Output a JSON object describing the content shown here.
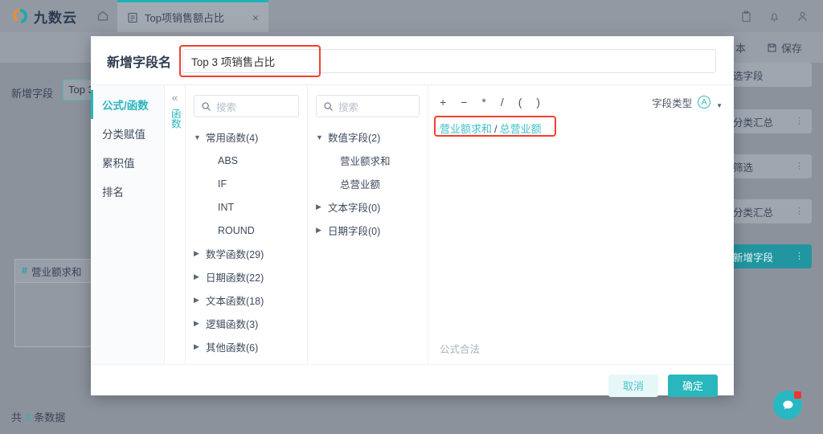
{
  "topbar": {
    "logo_text": "九数云",
    "logo_icon": "nine-cloud-logo",
    "home_icon": "home-icon",
    "tab": {
      "icon": "document-icon",
      "label": "Top项销售额占比",
      "close": "×"
    },
    "right_icons": [
      "clipboard-icon",
      "bell-icon",
      "user-icon"
    ]
  },
  "subbar": {
    "version_label": "本",
    "save_icon": "save-icon",
    "save_label": "保存"
  },
  "background": {
    "add_field_label": "新增字段",
    "chip_label": "Top 3",
    "table_column": {
      "icon": "hash-icon",
      "label": "营业额求和"
    },
    "footer_prefix": "共",
    "footer_count": "3",
    "footer_suffix": "条数据",
    "right_panel_items": [
      {
        "label": "选字段",
        "active": false,
        "has_menu": false
      },
      {
        "label": "分类汇总",
        "active": false,
        "has_menu": true
      },
      {
        "label": "筛选",
        "active": false,
        "has_menu": true
      },
      {
        "label": "分类汇总",
        "active": false,
        "has_menu": true
      },
      {
        "label": "新增字段",
        "active": true,
        "has_menu": true
      }
    ],
    "menu_dots": "⋮",
    "chat_icon": "chat-bubble-icon"
  },
  "modal": {
    "title": "新增字段名",
    "name_input_value": "Top 3 项销售占比",
    "nav_items": [
      {
        "label": "公式/函数",
        "active": true
      },
      {
        "label": "分类赋值",
        "active": false
      },
      {
        "label": "累积值",
        "active": false
      },
      {
        "label": "排名",
        "active": false
      }
    ],
    "collapse": {
      "icon": "double-chevron-left-icon",
      "vertical_label": "函数"
    },
    "search_placeholder": "搜索",
    "search_icon": "search-icon",
    "function_tree": [
      {
        "label": "常用函数(4)",
        "expanded": true,
        "children": [
          "ABS",
          "IF",
          "INT",
          "ROUND"
        ]
      },
      {
        "label": "数学函数(29)",
        "expanded": false,
        "children": []
      },
      {
        "label": "日期函数(22)",
        "expanded": false,
        "children": []
      },
      {
        "label": "文本函数(18)",
        "expanded": false,
        "children": []
      },
      {
        "label": "逻辑函数(3)",
        "expanded": false,
        "children": []
      },
      {
        "label": "其他函数(6)",
        "expanded": false,
        "children": []
      }
    ],
    "field_tree": [
      {
        "label": "数值字段(2)",
        "expanded": true,
        "children": [
          "营业额求和",
          "总营业额"
        ]
      },
      {
        "label": "文本字段(0)",
        "expanded": false,
        "children": []
      },
      {
        "label": "日期字段(0)",
        "expanded": false,
        "children": []
      }
    ],
    "operators": [
      "+",
      "−",
      "*",
      "/",
      "(",
      ")"
    ],
    "field_type_label": "字段类型",
    "field_type_icon": "circled-a-icon",
    "formula": {
      "field_1": "营业额求和",
      "operator": "/",
      "field_2": "总营业额"
    },
    "status_text": "公式合法",
    "cancel_label": "取消",
    "confirm_label": "确定"
  },
  "colors": {
    "accent": "#29b6bd",
    "highlight_red": "#f3402f",
    "field_token": "#3fc0cc",
    "notification": "#f4342c"
  }
}
